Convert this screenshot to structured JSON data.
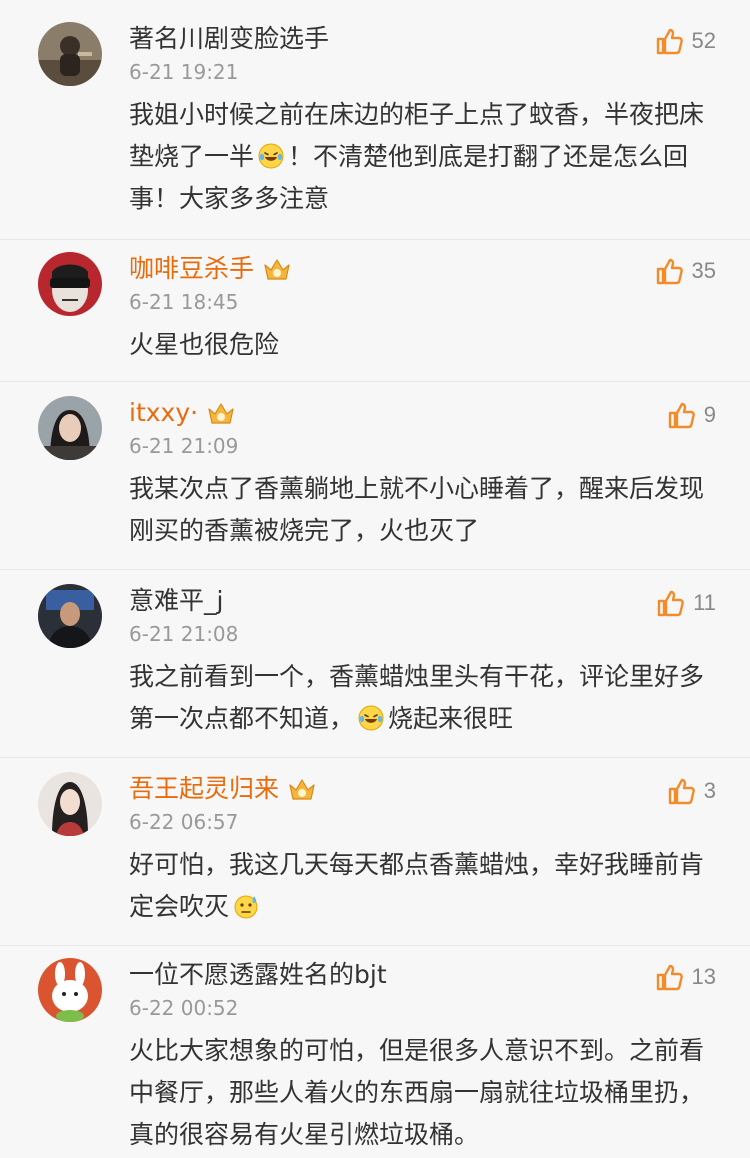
{
  "comments": [
    {
      "username": "著名川剧变脸选手",
      "vip": false,
      "time": "6-21 19:21",
      "likes": "52",
      "text_a": "我姐小时候之前在床边的柜子上点了蚊香，半夜把床垫烧了一半",
      "emoji": "laugh-cry-emoji",
      "text_b": "！不清楚他到底是打翻了还是怎么回事！大家多多注意"
    },
    {
      "username": "咖啡豆杀手",
      "vip": true,
      "time": "6-21 18:45",
      "likes": "35",
      "text_a": "火星也很危险"
    },
    {
      "username": "itxxy·",
      "vip": true,
      "time": "6-21 21:09",
      "likes": "9",
      "text_a": "我某次点了香薰躺地上就不小心睡着了，醒来后发现刚买的香薰被烧完了，火也灭了"
    },
    {
      "username": "意难平_j",
      "vip": false,
      "time": "6-21 21:08",
      "likes": "11",
      "text_a": "我之前看到一个，香薰蜡烛里头有干花，评论里好多第一次点都不知道，",
      "emoji": "laugh-cry-emoji",
      "text_b": "烧起来很旺"
    },
    {
      "username": "吾王起灵归来",
      "vip": true,
      "time": "6-22 06:57",
      "likes": "3",
      "text_a": "好可怕，我这几天每天都点香薰蜡烛，幸好我睡前肯定会吹灭",
      "emoji": "sweat-emoji"
    },
    {
      "username": "一位不愿透露姓名的bjt",
      "vip": false,
      "time": "6-22 00:52",
      "likes": "13",
      "text_a": "火比大家想象的可怕，但是很多人意识不到。之前看中餐厅，那些人着火的东西扇一扇就往垃圾桶里扔，真的很容易有火星引燃垃圾桶。"
    }
  ],
  "icons": {
    "like": "thumbs-up-icon",
    "vip": "crown-badge-icon"
  },
  "colors": {
    "vip_name": "#e86b0c",
    "username": "#333333",
    "time": "#999999",
    "like_icon": "#f28b2a"
  }
}
